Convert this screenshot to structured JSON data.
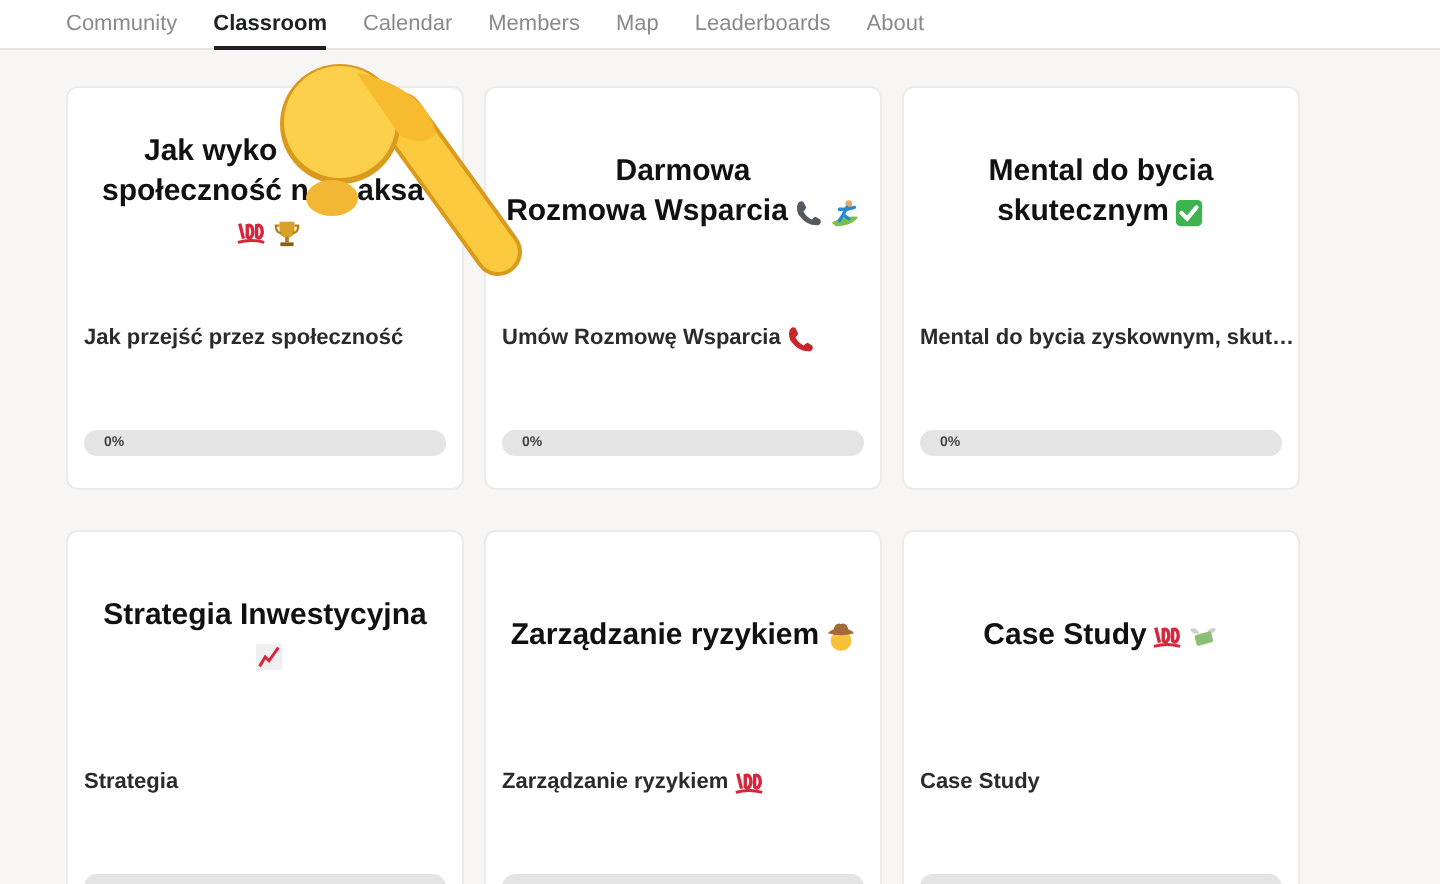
{
  "nav": {
    "tabs": [
      {
        "label": "Community",
        "selected": false
      },
      {
        "label": "Classroom",
        "selected": true
      },
      {
        "label": "Calendar",
        "selected": false
      },
      {
        "label": "Members",
        "selected": false
      },
      {
        "label": "Map",
        "selected": false
      },
      {
        "label": "Leaderboards",
        "selected": false
      },
      {
        "label": "About",
        "selected": false
      }
    ]
  },
  "courses": [
    {
      "title_lines": [
        [
          "Jak wyko"
        ],
        [
          "społeczność n",
          "aksa"
        ],
        [
          {
            "kind": "hundred"
          },
          {
            "kind": "trophy"
          }
        ]
      ],
      "subtitle": "Jak przejść przez społeczność",
      "progress": {
        "level": 0,
        "reading": "0%"
      }
    },
    {
      "title_lines": [
        [
          "Darmowa"
        ],
        [
          "Rozmowa Wsparcia",
          {
            "kind": "telephone"
          },
          {
            "kind": "surfer"
          }
        ]
      ],
      "subtitle": "Umów Rozmowę Wsparcia",
      "subtitle_icons": [
        {
          "kind": "red_phone"
        }
      ],
      "progress": {
        "level": 0,
        "reading": "0%"
      }
    },
    {
      "title_lines": [
        [
          "Mental do bycia"
        ],
        [
          "skutecznym",
          {
            "kind": "check"
          }
        ]
      ],
      "subtitle": "Mental do bycia zyskownym, skut…",
      "progress": {
        "level": 0,
        "reading": "0%"
      }
    },
    {
      "title_lines": [
        [
          "Strategia Inwestycyjna"
        ],
        [
          {
            "kind": "chart"
          }
        ]
      ],
      "subtitle": "Strategia",
      "progress": {
        "level": 0
      }
    },
    {
      "title_lines": [
        [
          "Zarządzanie ryzykiem",
          {
            "kind": "cowboy"
          }
        ]
      ],
      "subtitle": "Zarządzanie ryzykiem",
      "subtitle_icons": [
        {
          "kind": "hundred"
        }
      ],
      "progress": {
        "level": 0
      }
    },
    {
      "title_lines": [
        [
          "Case Study",
          {
            "kind": "hundred"
          },
          {
            "kind": "money"
          }
        ]
      ],
      "subtitle": "Case Study",
      "progress": {
        "level": 0
      }
    }
  ]
}
